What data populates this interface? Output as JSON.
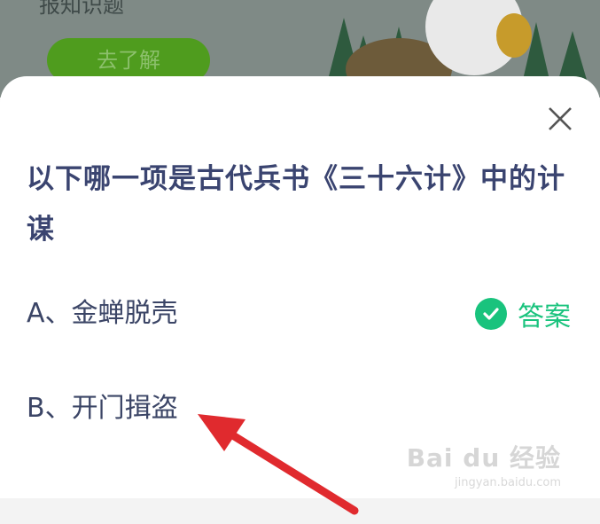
{
  "background": {
    "partial_text": "报知识题",
    "button_label": "去了解"
  },
  "modal": {
    "question": "以下哪一项是古代兵书《三十六计》中的计谋",
    "options": [
      {
        "label": "A、金蝉脱壳"
      },
      {
        "label": "B、开门揖盗"
      }
    ],
    "answer_label": "答案",
    "accent_color": "#19c37d",
    "close_icon": "close-icon",
    "check_icon": "check-circle-icon"
  },
  "watermark": {
    "logo_text": "Bai du 经验",
    "url": "jingyan.baidu.com"
  }
}
